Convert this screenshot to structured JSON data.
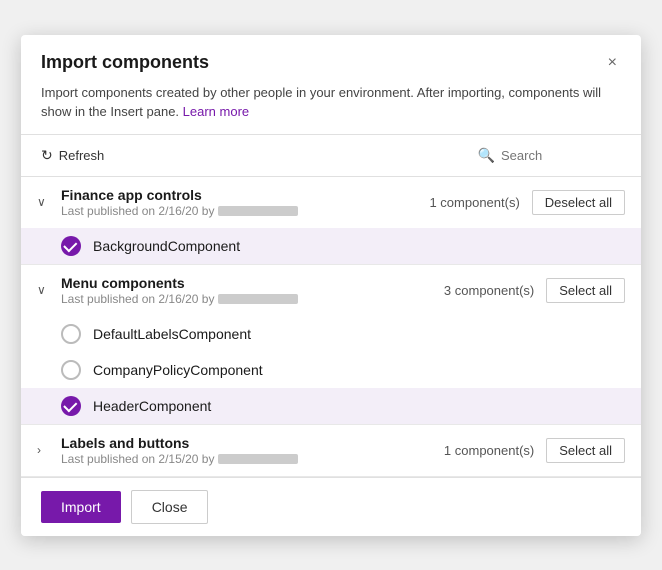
{
  "dialog": {
    "title": "Import components",
    "description": "Import components created by other people in your environment. After importing, components will show in the Insert pane.",
    "learn_more_label": "Learn more",
    "close_label": "×"
  },
  "toolbar": {
    "refresh_label": "Refresh",
    "search_placeholder": "Search"
  },
  "groups": [
    {
      "id": "finance",
      "name": "Finance app controls",
      "meta_prefix": "Last published on 2/16/20 by",
      "expanded": true,
      "component_count": "1 component(s)",
      "action_label": "Deselect all",
      "components": [
        {
          "name": "BackgroundComponent",
          "selected": true
        }
      ]
    },
    {
      "id": "menu",
      "name": "Menu components",
      "meta_prefix": "Last published on 2/16/20 by",
      "expanded": true,
      "component_count": "3 component(s)",
      "action_label": "Select all",
      "components": [
        {
          "name": "DefaultLabelsComponent",
          "selected": false
        },
        {
          "name": "CompanyPolicyComponent",
          "selected": false
        },
        {
          "name": "HeaderComponent",
          "selected": true
        }
      ]
    },
    {
      "id": "labels",
      "name": "Labels and buttons",
      "meta_prefix": "Last published on 2/15/20 by",
      "expanded": false,
      "component_count": "1 component(s)",
      "action_label": "Select all",
      "components": []
    }
  ],
  "footer": {
    "import_label": "Import",
    "close_label": "Close"
  }
}
